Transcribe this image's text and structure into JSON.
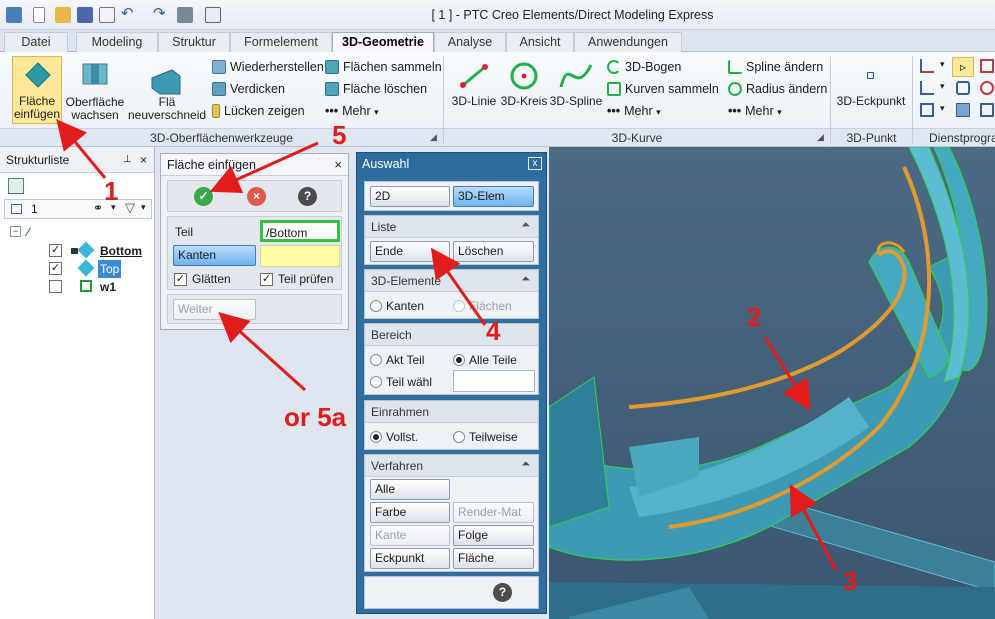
{
  "window": {
    "title": "[ 1 ] - PTC Creo Elements/Direct Modeling Express"
  },
  "tabs": [
    "Datei",
    "Modeling",
    "Struktur",
    "Formelement",
    "3D-Geometrie",
    "Analyse",
    "Ansicht",
    "Anwendungen"
  ],
  "ribbon": {
    "big": {
      "flaeche_einfuegen": [
        "Fläche",
        "einfügen"
      ],
      "oberflaeche_wachsen": [
        "Oberfläche",
        "wachsen"
      ],
      "flae_neuverschneid": [
        "Flä",
        "neuverschneid"
      ],
      "linie": "3D-Linie",
      "kreis": "3D-Kreis",
      "spline": "3D-Spline",
      "eckpunkt": "3D-Eckpunkt"
    },
    "small": {
      "wiederherstellen": "Wiederherstellen",
      "verdicken": "Verdicken",
      "luecken": "Lücken zeigen",
      "flaechen_sammeln": "Flächen sammeln",
      "flaeche_loeschen": "Fläche löschen",
      "mehr1": "Mehr",
      "bogen": "3D-Bogen",
      "kurven_sammeln": "Kurven sammeln",
      "mehr2": "Mehr",
      "spline_aendern": "Spline ändern",
      "radius_aendern": "Radius ändern",
      "mehr3": "Mehr"
    },
    "groups": {
      "g1": "3D-Oberflächenwerkzeuge",
      "g2": "3D-Kurve",
      "g3": "3D-Punkt",
      "g4": "Dienstprogra"
    }
  },
  "structure": {
    "title": "Strukturliste",
    "filter_value": "1",
    "items": [
      {
        "label": "Bottom",
        "checked": true
      },
      {
        "label": "Top",
        "checked": true
      },
      {
        "label": "w1",
        "checked": false
      }
    ]
  },
  "dialog": {
    "title": "Fläche einfügen",
    "teil_label": "Teil",
    "teil_value": "/Bottom",
    "kanten_label": "Kanten",
    "glaetten": "Glätten",
    "teil_pruefen": "Teil prüfen",
    "weiter": "Weiter",
    "help": "?"
  },
  "auswahl": {
    "title": "Auswahl",
    "close": "x",
    "mode_2d": "2D",
    "mode_3d": "3D-Elem",
    "liste": {
      "title": "Liste",
      "ende": "Ende",
      "loeschen": "Löschen"
    },
    "elemente": {
      "title": "3D-Elemente",
      "kanten": "Kanten",
      "flaechen": "Flächen"
    },
    "bereich": {
      "title": "Bereich",
      "akt_teil": "Akt Teil",
      "alle_teile": "Alle Teile",
      "teil_waehl": "Teil wähl"
    },
    "einrahmen": {
      "title": "Einrahmen",
      "vollst": "Vollst.",
      "teilweise": "Teilweise"
    },
    "verfahren": {
      "title": "Verfahren",
      "alle": "Alle",
      "farbe": "Farbe",
      "render_mat": "Render-Mat",
      "kante": "Kante",
      "folge": "Folge",
      "eckpunkt": "Eckpunkt",
      "flaeche": "Fläche"
    },
    "help": "?"
  },
  "annotations": {
    "a1": "1",
    "a2": "2",
    "a3": "3",
    "a4": "4",
    "a5": "5",
    "a5a": "or 5a"
  },
  "colors": {
    "accent_blue": "#2f6e9e",
    "annotation_red": "#e21c1c",
    "model_cyan": "#3a9ab3",
    "edge_orange": "#e19a2e",
    "selected_yellow": "#fde79b"
  }
}
